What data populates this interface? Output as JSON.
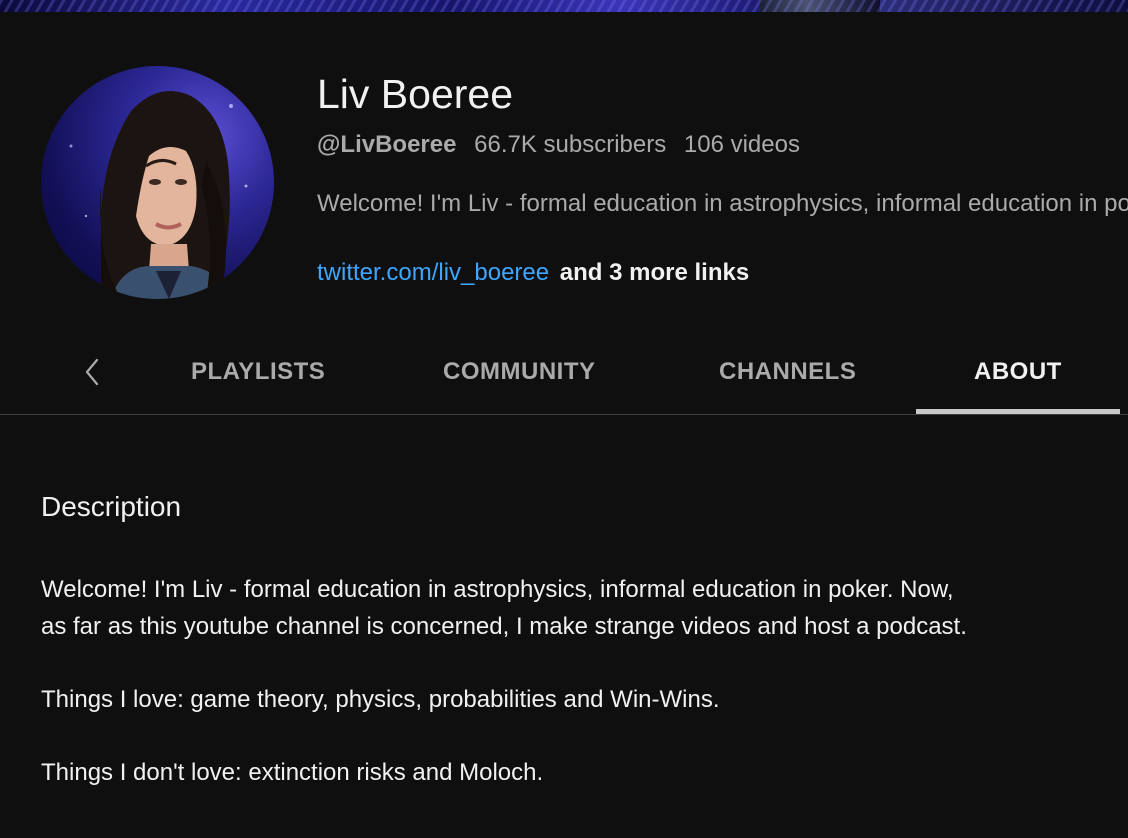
{
  "channel": {
    "name": "Liv Boeree",
    "handle": "@LivBoeree",
    "subscribers": "66.7K subscribers",
    "videos": "106 videos",
    "tagline": "Welcome! I'm Liv - formal education in astrophysics, informal education in poker.",
    "link": "twitter.com/liv_boeree",
    "more_links": "and 3 more links"
  },
  "tabs": {
    "items": [
      {
        "label": "PLAYLISTS"
      },
      {
        "label": "COMMUNITY"
      },
      {
        "label": "CHANNELS"
      },
      {
        "label": "ABOUT"
      }
    ],
    "active": "ABOUT"
  },
  "about": {
    "section_title": "Description",
    "paragraphs": [
      "Welcome! I'm Liv - formal education in astrophysics, informal education in poker. Now, as far as this youtube channel is concerned, I make strange videos and host a podcast.",
      "Things I love: game theory, physics, probabilities and Win-Wins.",
      "Things I don't love: extinction risks and Moloch."
    ]
  },
  "icons": {
    "tab_prev": "chevron-left-icon"
  },
  "colors": {
    "background": "#0f0f0f",
    "link": "#3ea6ff",
    "muted_text": "#aaaaaa",
    "primary_text": "#f1f1f1"
  }
}
